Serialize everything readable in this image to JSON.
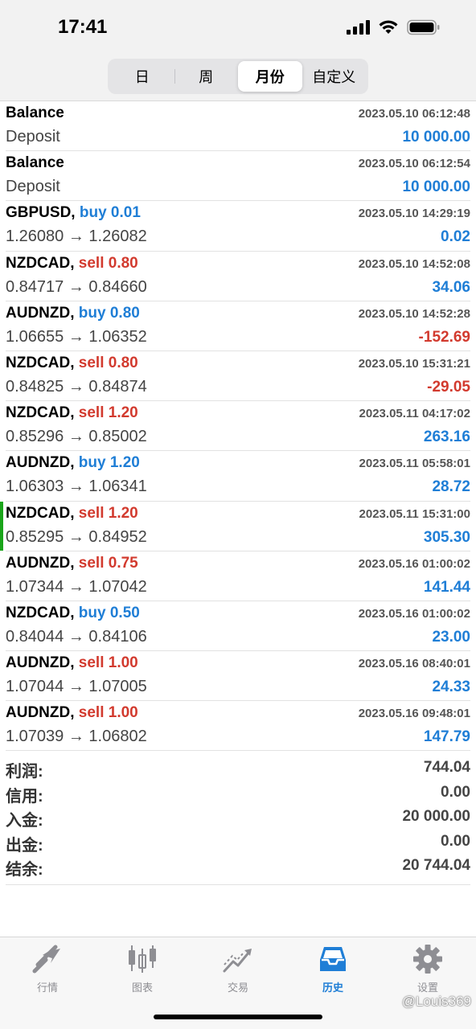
{
  "status_bar": {
    "time": "17:41"
  },
  "period_tabs": [
    {
      "label": "日",
      "active": false
    },
    {
      "label": "周",
      "active": false
    },
    {
      "label": "月份",
      "active": true
    },
    {
      "label": "自定义",
      "active": false
    }
  ],
  "trades": [
    {
      "symbol": "Balance",
      "side": "",
      "volume": "",
      "detail": "Deposit",
      "time": "2023.05.10 06:12:48",
      "amount": "10 000.00",
      "amount_sign": "pos",
      "marked": false
    },
    {
      "symbol": "Balance",
      "side": "",
      "volume": "",
      "detail": "Deposit",
      "time": "2023.05.10 06:12:54",
      "amount": "10 000.00",
      "amount_sign": "pos",
      "marked": false
    },
    {
      "symbol": "GBPUSD,",
      "side": "buy",
      "volume": "0.01",
      "detail": "1.26080 → 1.26082",
      "time": "2023.05.10 14:29:19",
      "amount": "0.02",
      "amount_sign": "pos",
      "marked": false
    },
    {
      "symbol": "NZDCAD,",
      "side": "sell",
      "volume": "0.80",
      "detail": "0.84717 → 0.84660",
      "time": "2023.05.10 14:52:08",
      "amount": "34.06",
      "amount_sign": "pos",
      "marked": false
    },
    {
      "symbol": "AUDNZD,",
      "side": "buy",
      "volume": "0.80",
      "detail": "1.06655 → 1.06352",
      "time": "2023.05.10 14:52:28",
      "amount": "-152.69",
      "amount_sign": "neg",
      "marked": false
    },
    {
      "symbol": "NZDCAD,",
      "side": "sell",
      "volume": "0.80",
      "detail": "0.84825 → 0.84874",
      "time": "2023.05.10 15:31:21",
      "amount": "-29.05",
      "amount_sign": "neg",
      "marked": false
    },
    {
      "symbol": "NZDCAD,",
      "side": "sell",
      "volume": "1.20",
      "detail": "0.85296 → 0.85002",
      "time": "2023.05.11 04:17:02",
      "amount": "263.16",
      "amount_sign": "pos",
      "marked": false
    },
    {
      "symbol": "AUDNZD,",
      "side": "buy",
      "volume": "1.20",
      "detail": "1.06303 → 1.06341",
      "time": "2023.05.11 05:58:01",
      "amount": "28.72",
      "amount_sign": "pos",
      "marked": false
    },
    {
      "symbol": "NZDCAD,",
      "side": "sell",
      "volume": "1.20",
      "detail": "0.85295 → 0.84952",
      "time": "2023.05.11 15:31:00",
      "amount": "305.30",
      "amount_sign": "pos",
      "marked": true
    },
    {
      "symbol": "AUDNZD,",
      "side": "sell",
      "volume": "0.75",
      "detail": "1.07344 → 1.07042",
      "time": "2023.05.16 01:00:02",
      "amount": "141.44",
      "amount_sign": "pos",
      "marked": false
    },
    {
      "symbol": "NZDCAD,",
      "side": "buy",
      "volume": "0.50",
      "detail": "0.84044 → 0.84106",
      "time": "2023.05.16 01:00:02",
      "amount": "23.00",
      "amount_sign": "pos",
      "marked": false
    },
    {
      "symbol": "AUDNZD,",
      "side": "sell",
      "volume": "1.00",
      "detail": "1.07044 → 1.07005",
      "time": "2023.05.16 08:40:01",
      "amount": "24.33",
      "amount_sign": "pos",
      "marked": false
    },
    {
      "symbol": "AUDNZD,",
      "side": "sell",
      "volume": "1.00",
      "detail": "1.07039 → 1.06802",
      "time": "2023.05.16 09:48:01",
      "amount": "147.79",
      "amount_sign": "pos",
      "marked": false
    }
  ],
  "summary": [
    {
      "label": "利润:",
      "value": "744.04"
    },
    {
      "label": "信用:",
      "value": "0.00"
    },
    {
      "label": "入金:",
      "value": "20 000.00"
    },
    {
      "label": "出金:",
      "value": "0.00"
    },
    {
      "label": "结余:",
      "value": "20 744.04"
    }
  ],
  "tabbar": [
    {
      "label": "行情",
      "icon": "quotes-icon",
      "active": false
    },
    {
      "label": "图表",
      "icon": "chart-icon",
      "active": false
    },
    {
      "label": "交易",
      "icon": "trade-icon",
      "active": false
    },
    {
      "label": "历史",
      "icon": "history-icon",
      "active": true
    },
    {
      "label": "设置",
      "icon": "gear-icon",
      "active": false
    }
  ],
  "watermark": "@Louis369",
  "colors": {
    "buy": "#1f7ed6",
    "sell": "#d23a2e",
    "positive": "#1f7ed6",
    "negative": "#d23a2e",
    "marker": "#1aa51a",
    "active_tab": "#1f7ed6"
  }
}
